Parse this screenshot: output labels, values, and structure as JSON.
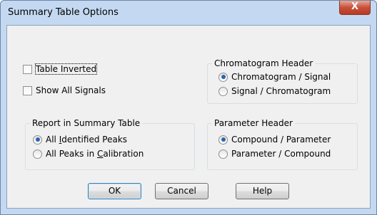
{
  "window": {
    "title": "Summary Table Options",
    "close_glyph": "X"
  },
  "options": {
    "table_inverted": {
      "label": "Table Inverted",
      "checked": false
    },
    "show_all_signals": {
      "label": "Show All Signals",
      "checked": false
    }
  },
  "chromatogram_header": {
    "title": "Chromatogram Header",
    "items": [
      {
        "label": "Chromatogram / Signal",
        "selected": true
      },
      {
        "label": "Signal / Chromatogram",
        "selected": false
      }
    ]
  },
  "report": {
    "title": "Report in Summary Table",
    "items": [
      {
        "pre": "All ",
        "ul": "I",
        "post": "dentified Peaks",
        "selected": true
      },
      {
        "pre": "All Peaks in ",
        "ul": "C",
        "post": "alibration",
        "selected": false
      }
    ]
  },
  "parameter_header": {
    "title": "Parameter Header",
    "items": [
      {
        "label": "Compound / Parameter",
        "selected": true
      },
      {
        "label": "Parameter / Compound",
        "selected": false
      }
    ]
  },
  "buttons": {
    "ok": "OK",
    "cancel": "Cancel",
    "help": "Help"
  }
}
